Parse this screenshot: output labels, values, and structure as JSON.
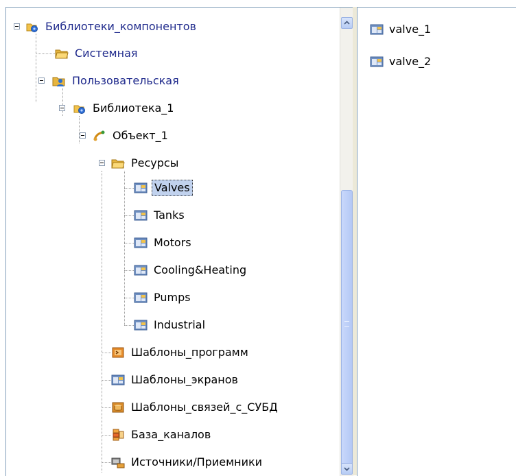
{
  "tree": {
    "libraries": "Библиотеки_компонентов",
    "system": "Системная",
    "user": "Пользовательская",
    "library1": "Библиотека_1",
    "object1": "Объект_1",
    "resources": "Ресурсы",
    "resource_items": [
      "Valves",
      "Tanks",
      "Motors",
      "Cooling&Heating",
      "Pumps",
      "Industrial"
    ],
    "program_templates": "Шаблоны_программ",
    "screen_templates": "Шаблоны_экранов",
    "db_link_templates": "Шаблоны_связей_с_СУБД",
    "channel_base": "База_каналов",
    "sources_receivers": "Источники/Приемники"
  },
  "list": {
    "items": [
      "valve_1",
      "valve_2"
    ]
  }
}
